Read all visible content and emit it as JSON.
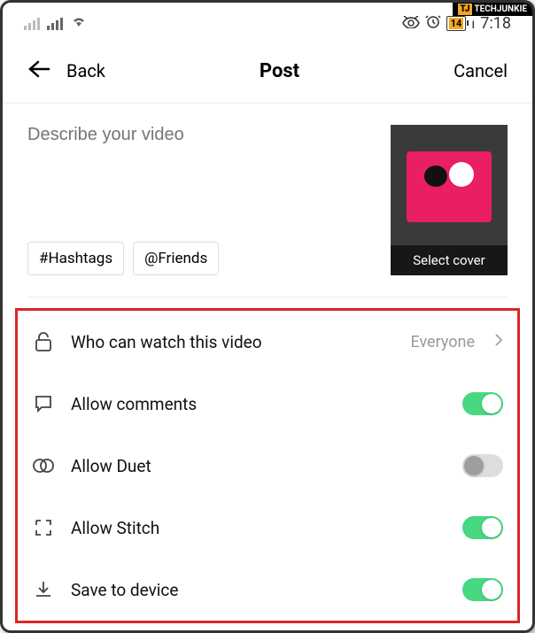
{
  "logo": {
    "prefix": "TJ",
    "text": "TECHJUNKIE"
  },
  "status": {
    "battery": "14",
    "time": "7:18"
  },
  "nav": {
    "back": "Back",
    "title": "Post",
    "cancel": "Cancel"
  },
  "compose": {
    "placeholder": "Describe your video",
    "hashtags": "#Hashtags",
    "friends": "@Friends",
    "select_cover": "Select cover"
  },
  "settings": {
    "privacy": {
      "label": "Who can watch this video",
      "value": "Everyone"
    },
    "comments": {
      "label": "Allow comments",
      "on": true
    },
    "duet": {
      "label": "Allow Duet",
      "on": false
    },
    "stitch": {
      "label": "Allow Stitch",
      "on": true
    },
    "save": {
      "label": "Save to device",
      "on": true
    }
  }
}
